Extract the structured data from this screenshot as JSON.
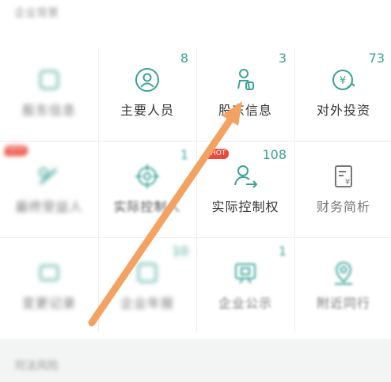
{
  "section": {
    "title": "企业背景"
  },
  "bottom": {
    "title": "司法风险"
  },
  "grid": {
    "row1": [
      {
        "label": "股东信息",
        "count": ""
      },
      {
        "label": "主要人员",
        "count": "8"
      },
      {
        "label": "股东信息",
        "count": "3"
      },
      {
        "label": "对外投资",
        "count": "73"
      }
    ],
    "row2": [
      {
        "label": "最终受益人",
        "count": ""
      },
      {
        "label": "实际控制人",
        "count": "1"
      },
      {
        "label": "实际控制权",
        "count": "108",
        "badge": "HOT"
      },
      {
        "label": "财务简析",
        "count": ""
      }
    ],
    "row3": [
      {
        "label": "变更记录",
        "count": ""
      },
      {
        "label": "企业年报",
        "count": "10"
      },
      {
        "label": "企业公示",
        "count": "1"
      },
      {
        "label": "附近同行",
        "count": ""
      }
    ]
  },
  "badges": {
    "hot": "HOT",
    "new": "NEW"
  },
  "colors": {
    "accent": "#3aa394",
    "arrow": "#f4a261",
    "hot": "#ea4a3c"
  }
}
